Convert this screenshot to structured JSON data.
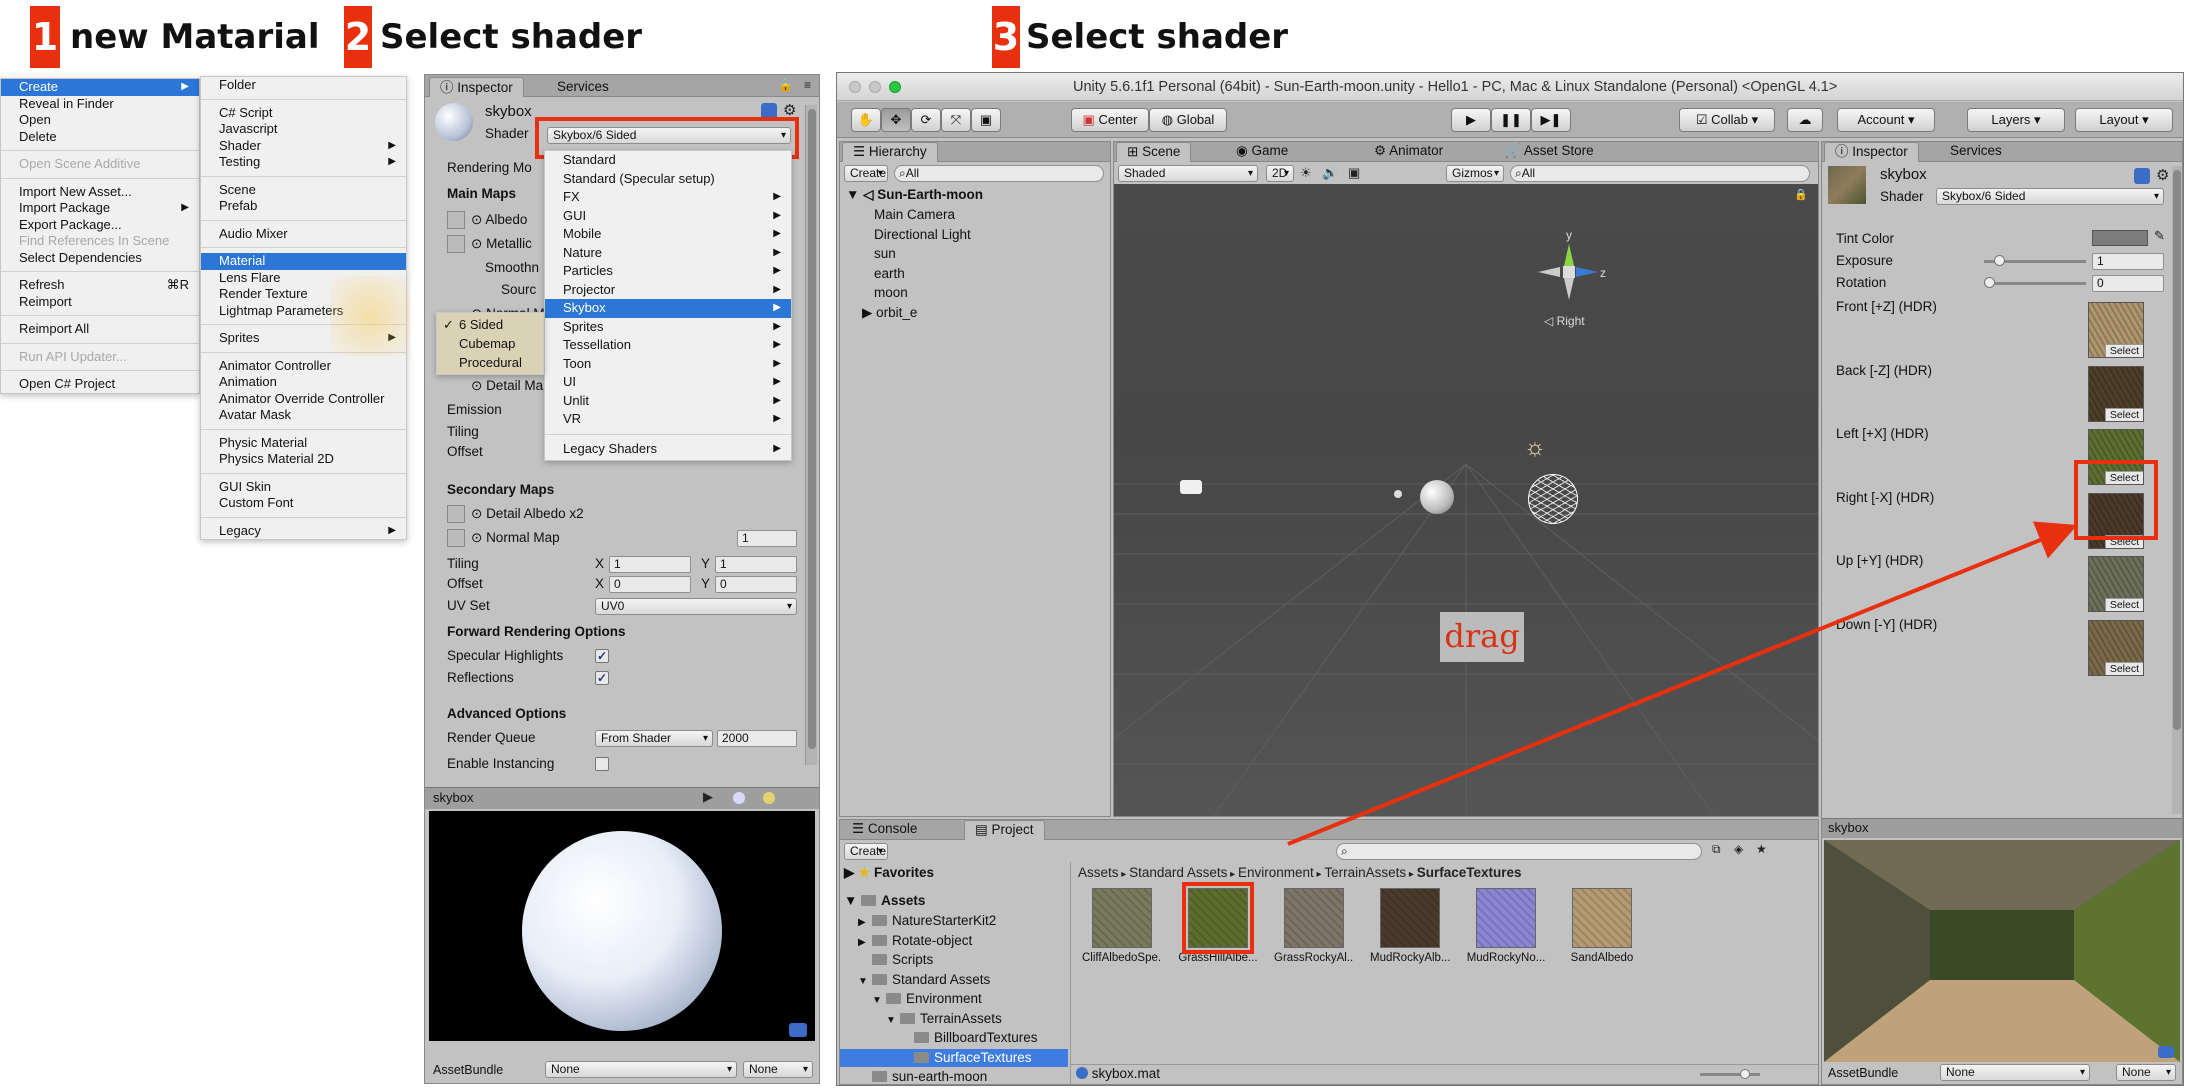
{
  "steps": [
    {
      "num": "1",
      "title": "new Matarial"
    },
    {
      "num": "2",
      "title": "Select shader"
    },
    {
      "num": "3",
      "title": "Select shader"
    }
  ],
  "context_menu": {
    "col1": [
      {
        "label": "Create",
        "state": "selected",
        "arrow": true
      },
      {
        "label": "Reveal in Finder"
      },
      {
        "label": "Open"
      },
      {
        "label": "Delete"
      },
      {
        "sep": true
      },
      {
        "label": "Open Scene Additive",
        "state": "disabled"
      },
      {
        "sep": true
      },
      {
        "label": "Import New Asset..."
      },
      {
        "label": "Import Package",
        "arrow": true
      },
      {
        "label": "Export Package..."
      },
      {
        "label": "Find References In Scene",
        "state": "disabled"
      },
      {
        "label": "Select Dependencies"
      },
      {
        "sep": true
      },
      {
        "label": "Refresh",
        "key": "⌘R"
      },
      {
        "label": "Reimport"
      },
      {
        "sep": true
      },
      {
        "label": "Reimport All"
      },
      {
        "sep": true
      },
      {
        "label": "Run API Updater...",
        "state": "disabled"
      },
      {
        "sep": true
      },
      {
        "label": "Open C# Project"
      }
    ],
    "col2": [
      {
        "label": "Folder"
      },
      {
        "sep": true
      },
      {
        "label": "C# Script"
      },
      {
        "label": "Javascript"
      },
      {
        "label": "Shader",
        "arrow": true
      },
      {
        "label": "Testing",
        "arrow": true
      },
      {
        "sep": true
      },
      {
        "label": "Scene"
      },
      {
        "label": "Prefab"
      },
      {
        "sep": true
      },
      {
        "label": "Audio Mixer"
      },
      {
        "sep": true
      },
      {
        "label": "Material",
        "state": "selected"
      },
      {
        "label": "Lens Flare"
      },
      {
        "label": "Render Texture"
      },
      {
        "label": "Lightmap Parameters"
      },
      {
        "sep": true
      },
      {
        "label": "Sprites",
        "arrow": true
      },
      {
        "sep": true
      },
      {
        "label": "Animator Controller"
      },
      {
        "label": "Animation"
      },
      {
        "label": "Animator Override Controller"
      },
      {
        "label": "Avatar Mask"
      },
      {
        "sep": true
      },
      {
        "label": "Physic Material"
      },
      {
        "label": "Physics Material 2D"
      },
      {
        "sep": true
      },
      {
        "label": "GUI Skin"
      },
      {
        "label": "Custom Font"
      },
      {
        "sep": true
      },
      {
        "label": "Legacy",
        "arrow": true
      }
    ]
  },
  "inspector2": {
    "tabs": [
      "Inspector",
      "Services"
    ],
    "name": "skybox",
    "shader_label": "Shader",
    "shader_value": "Skybox/6 Sided",
    "rendering_mode": "Rendering Mo",
    "main_maps": "Main Maps",
    "albedo": "Albedo",
    "metallic": "Metallic",
    "smoothness": "Smoothn",
    "source": "Sourc",
    "normal": "Normal Ma",
    "detail_mask": "Detail Ma",
    "emission": "Emission",
    "tiling": "Tiling",
    "offset": "Offset",
    "secondary_maps": "Secondary Maps",
    "detail_albedo": "Detail Albedo x2",
    "normal_map": "Normal Map",
    "normal_map_val": "1",
    "tiling2": "Tiling",
    "offset2": "Offset",
    "x_label": "X",
    "y_label": "Y",
    "tiling_x": "1",
    "tiling_y": "1",
    "offset_x": "0",
    "offset_y": "0",
    "uv_set": "UV Set",
    "uv_set_value": "UV0",
    "forward": "Forward Rendering Options",
    "spec_high": "Specular Highlights",
    "reflections": "Reflections",
    "advanced": "Advanced Options",
    "render_queue": "Render Queue",
    "render_queue_mode": "From Shader",
    "render_queue_value": "2000",
    "enable_instancing": "Enable Instancing",
    "preview_title": "skybox",
    "assetbundle": "AssetBundle",
    "none1": "None",
    "none2": "None"
  },
  "shader_menu": [
    {
      "label": "Standard"
    },
    {
      "label": "Standard (Specular setup)"
    },
    {
      "label": "FX",
      "arrow": true
    },
    {
      "label": "GUI",
      "arrow": true
    },
    {
      "label": "Mobile",
      "arrow": true
    },
    {
      "label": "Nature",
      "arrow": true
    },
    {
      "label": "Particles",
      "arrow": true
    },
    {
      "label": "Projector",
      "arrow": true
    },
    {
      "label": "Skybox",
      "arrow": true,
      "state": "selected"
    },
    {
      "label": "Sprites",
      "arrow": true
    },
    {
      "label": "Tessellation",
      "arrow": true
    },
    {
      "label": "Toon",
      "arrow": true
    },
    {
      "label": "UI",
      "arrow": true
    },
    {
      "label": "Unlit",
      "arrow": true
    },
    {
      "label": "VR",
      "arrow": true
    },
    {
      "sep": true
    },
    {
      "label": "Legacy Shaders",
      "arrow": true
    }
  ],
  "skybox_submenu": [
    "6 Sided",
    "Cubemap",
    "Procedural"
  ],
  "unity": {
    "title": "Unity 5.6.1f1 Personal (64bit) - Sun-Earth-moon.unity - Hello1 - PC, Mac & Linux Standalone (Personal) <OpenGL 4.1>",
    "center": "Center",
    "global": "Global",
    "collab": "Collab",
    "account": "Account",
    "layers": "Layers",
    "layout": "Layout",
    "hierarchy_tab": "Hierarchy",
    "create": "Create",
    "search_all": "All",
    "scene_root": "Sun-Earth-moon",
    "hierarchy_items": [
      "Main Camera",
      "Directional Light",
      "sun",
      "earth",
      "moon",
      "orbit_e"
    ],
    "scene_tab": "Scene",
    "game_tab": "Game",
    "animator_tab": "Animator",
    "asset_store_tab": "Asset Store",
    "shaded": "Shaded",
    "mode_2d": "2D",
    "gizmos": "Gizmos",
    "gizmo_y": "y",
    "gizmo_z": "z",
    "gizmo_persp": "Right",
    "drag_label": "drag",
    "console_tab": "Console",
    "project_tab": "Project",
    "favorites": "Favorites",
    "assets_root": "Assets",
    "project_tree": [
      {
        "label": "NatureStarterKit2",
        "indent": 1,
        "arrow": "▶"
      },
      {
        "label": "Rotate-object",
        "indent": 1,
        "arrow": "▶"
      },
      {
        "label": "Scripts",
        "indent": 1,
        "arrow": ""
      },
      {
        "label": "Standard Assets",
        "indent": 1,
        "arrow": "▼"
      },
      {
        "label": "Environment",
        "indent": 2,
        "arrow": "▼"
      },
      {
        "label": "TerrainAssets",
        "indent": 3,
        "arrow": "▼"
      },
      {
        "label": "BillboardTextures",
        "indent": 4,
        "arrow": ""
      },
      {
        "label": "SurfaceTextures",
        "indent": 4,
        "arrow": "",
        "selected": true
      },
      {
        "label": "sun-earth-moon",
        "indent": 1,
        "arrow": ""
      }
    ],
    "breadcrumb": [
      "Assets",
      "Standard Assets",
      "Environment",
      "TerrainAssets",
      "SurfaceTextures"
    ],
    "assets": [
      {
        "label": "CliffAlbedoSpe...",
        "color": "#7a7a5c"
      },
      {
        "label": "GrassHillAlbe...",
        "color": "#5d6e2c"
      },
      {
        "label": "GrassRockyAl...",
        "color": "#7d7567"
      },
      {
        "label": "MudRockyAlb...",
        "color": "#4a3a2c"
      },
      {
        "label": "MudRockyNo...",
        "color": "#8a86d4"
      },
      {
        "label": "SandAlbedo",
        "color": "#b59a72"
      }
    ],
    "footer_file": "skybox.mat",
    "insp_tabs": [
      "Inspector",
      "Services"
    ],
    "insp_name": "skybox",
    "insp_shader_label": "Shader",
    "insp_shader_value": "Skybox/6 Sided",
    "tint_color": "Tint Color",
    "exposure": "Exposure",
    "exposure_value": "1",
    "exposure_level": 0.1,
    "rotation": "Rotation",
    "rotation_value": "0",
    "rotation_level": 0,
    "faces": [
      {
        "label": "Front [+Z]   (HDR)",
        "color": "#b0966e"
      },
      {
        "label": "Back [-Z]   (HDR)",
        "color": "#4e3f2a"
      },
      {
        "label": "Left [+X]   (HDR)",
        "color": "#5e7030"
      },
      {
        "label": "Right [-X]   (HDR)",
        "color": "#4b3a2a"
      },
      {
        "label": "Up [+Y]   (HDR)",
        "color": "#6e705a"
      },
      {
        "label": "Down [-Y]   (HDR)",
        "color": "#7a6a4a"
      }
    ],
    "select_label": "Select",
    "preview_title": "skybox",
    "assetbundle": "AssetBundle",
    "none1": "None",
    "none2": "None"
  },
  "colors": {
    "highlight": "#2b76d6",
    "annotation": "#e8300f",
    "panel": "#c2c2c2"
  }
}
